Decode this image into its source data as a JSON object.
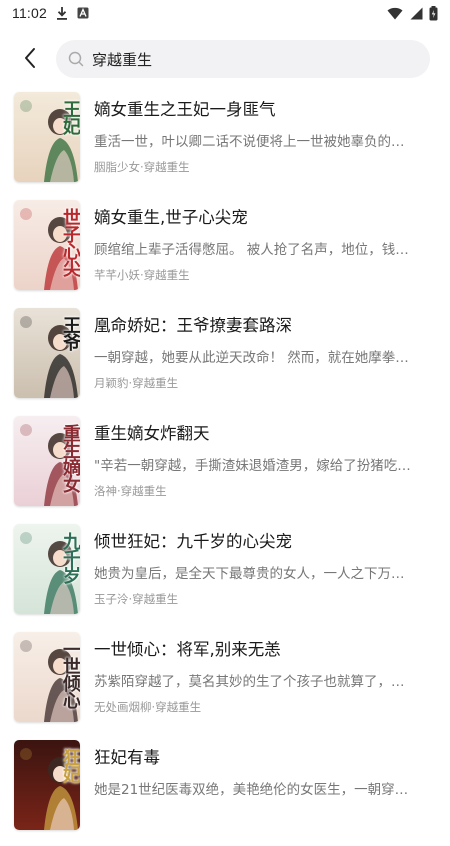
{
  "status_bar": {
    "time": "11:02",
    "icons": [
      "download-icon",
      "app-a-icon",
      "wifi-icon",
      "signal-icon",
      "battery-icon"
    ]
  },
  "search": {
    "query": "穿越重生",
    "placeholder": ""
  },
  "books": [
    {
      "title": "嫡女重生之王妃一身匪气",
      "description": "重活一世，叶以卿二话不说便将上一世被她辜负的…",
      "author": "胭脂少女",
      "category": "穿越重生",
      "cover_text": "王妃",
      "cover_color": "#2f6b3a"
    },
    {
      "title": "嫡女重生,世子心尖宠",
      "description": "顾绾绾上辈子活得憋屈。 被人抢了名声，地位，钱…",
      "author": "芊芊小妖",
      "category": "穿越重生",
      "cover_text": "世子心尖",
      "cover_color": "#b8282c"
    },
    {
      "title": "凰命娇妃：王爷撩妻套路深",
      "description": "一朝穿越，她要从此逆天改命！ 然而，就在她摩拳…",
      "author": "月颖豹",
      "category": "穿越重生",
      "cover_text": "王爷",
      "cover_color": "#1b1b1b"
    },
    {
      "title": "重生嫡女炸翻天",
      "description": "\"辛若一朝穿越，手撕渣妹退婚渣男，嫁给了扮猪吃…",
      "author": "洛神",
      "category": "穿越重生",
      "cover_text": "重生嫡女",
      "cover_color": "#8a2a33"
    },
    {
      "title": "倾世狂妃：九千岁的心尖宠",
      "description": "她贵为皇后，是全天下最尊贵的女人，一人之下万…",
      "author": "玉子泠",
      "category": "穿越重生",
      "cover_text": "九千岁",
      "cover_color": "#2e6f57"
    },
    {
      "title": "一世倾心：将军,别来无恙",
      "description": "苏紫陌穿越了，莫名其妙的生了个孩子也就算了，…",
      "author": "无处画烟柳",
      "category": "穿越重生",
      "cover_text": "一世倾心",
      "cover_color": "#3a2a2a"
    },
    {
      "title": "狂妃有毒",
      "description": "她是21世纪医毒双绝，美艳绝伦的女医生，一朝穿…",
      "author": "",
      "category": "",
      "cover_text": "狂妃",
      "cover_color": "#c8a040"
    }
  ],
  "meta_separator": "·"
}
